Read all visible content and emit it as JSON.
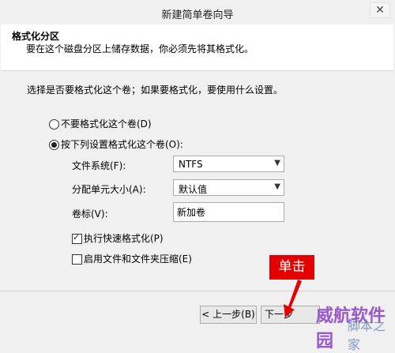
{
  "window": {
    "title": "新建简单卷向导",
    "close_symbol": "✕"
  },
  "header": {
    "title": "格式化分区",
    "description": "要在这个磁盘分区上储存数据，你必须先将其格式化。"
  },
  "main": {
    "prompt": "选择是否要格式化这个卷；如果要格式化，要使用什么设置。",
    "options": [
      {
        "label": "不要格式化这个卷(D)",
        "checked": false
      },
      {
        "label": "按下列设置格式化这个卷(O):",
        "checked": true
      }
    ],
    "fields": {
      "filesystem": {
        "label": "文件系统(F):",
        "value": "NTFS"
      },
      "allocation": {
        "label": "分配单元大小(A):",
        "value": "默认值"
      },
      "volume_label": {
        "label": "卷标(V):",
        "value": "新加卷"
      }
    },
    "checkboxes": [
      {
        "label": "执行快速格式化(P)",
        "checked": true
      },
      {
        "label": "启用文件和文件夹压缩(E)",
        "checked": false
      }
    ]
  },
  "footer": {
    "back_label": "< 上一步(B)",
    "next_label": "下一步"
  },
  "annotation": {
    "label": "单击",
    "color": "#e30000"
  },
  "watermark": {
    "text1": "威航软件园",
    "text2": "脚本之家"
  }
}
